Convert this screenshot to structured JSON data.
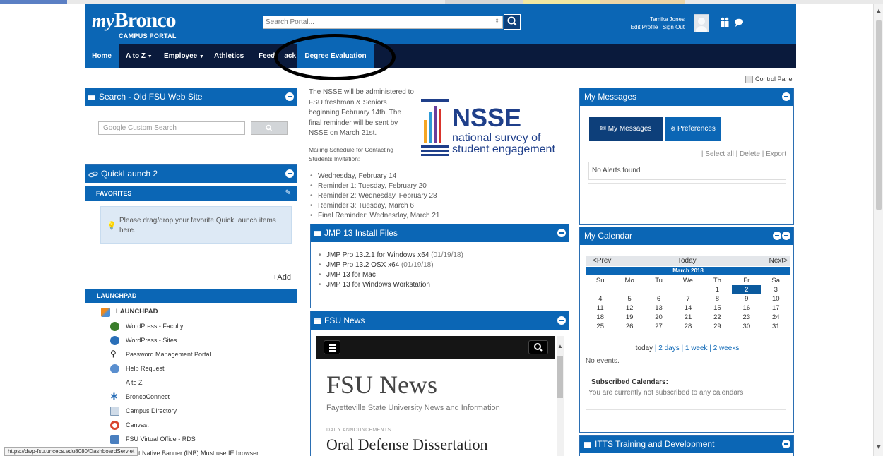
{
  "header": {
    "logo_my": "my",
    "logo_bronco": "Bronco",
    "logo_sub": "CAMPUS PORTAL",
    "search_placeholder": "Search Portal...",
    "user_name": "Tamika Jones",
    "user_links": "Edit Profile | Sign Out"
  },
  "nav": {
    "items": [
      "Home",
      "A to Z",
      "Employee",
      "Athletics",
      "Feedback",
      "Degree Evaluation"
    ],
    "feed_visible_left": "Feed",
    "feed_visible_right": "ack"
  },
  "control_panel": "Control Panel",
  "search_old": {
    "title": "Search - Old FSU Web Site",
    "placeholder": "Google Custom Search"
  },
  "quicklaunch": {
    "title": "QuickLaunch 2",
    "favorites": "FAVORITES",
    "drag_hint": "Please drag/drop your favorite QuickLaunch items here.",
    "add": "+Add",
    "launchpad_bar": "LAUNCHPAD",
    "launchpad_heading": "LAUNCHPAD",
    "items": [
      "WordPress - Faculty",
      "WordPress - Sites",
      "Password Management Portal",
      "Help Request",
      "A to Z",
      "BroncoConnect",
      "Campus Directory",
      "Canvas.",
      "FSU Virtual Office - RDS",
      "rnet Native Banner (INB) Must use IE browser."
    ]
  },
  "nsse": {
    "intro": "The NSSE will be administered to FSU freshman & Seniors beginning February 14th. The final reminder will be sent by NSSE on March 21st.",
    "mailing": "Mailing Schedule for Contacting Students Invitation:",
    "schedule": [
      "Wednesday, February 14",
      "Reminder 1:  Tuesday, February 20",
      "Reminder 2:  Wednesday, February 28",
      "Reminder 3:  Tuesday, March 6",
      "Final Reminder:  Wednesday, March 21"
    ],
    "logo_title": "NSSE",
    "logo_line1": "national survey of",
    "logo_line2": "student engagement"
  },
  "jmp": {
    "title": "JMP 13 Install Files",
    "items": [
      {
        "text": "JMP Pro 13.2.1 for Windows x64",
        "date": " (01/19/18)"
      },
      {
        "text": "JMP Pro 13.2 OSX x64",
        "date": " (01/19/18)"
      },
      {
        "text": "JMP 13 for Mac",
        "date": ""
      },
      {
        "text": "JMP 13 for Windows Workstation",
        "date": ""
      }
    ]
  },
  "fsu_news": {
    "title": "FSU News",
    "headline": "FSU News",
    "subtitle": "Fayetteville State University News and Information",
    "kicker": "DAILY ANNOUNCEMENTS",
    "story": "Oral Defense Dissertation"
  },
  "messages": {
    "title": "My Messages",
    "tab_messages": "My Messages",
    "tab_preferences": "Preferences",
    "actions": "| Select all  |  Delete  |  Export",
    "empty": "No Alerts found"
  },
  "calendar": {
    "title": "My Calendar",
    "prev": "<Prev",
    "today": "Today",
    "next": "Next>",
    "month": "March 2018",
    "weekdays": [
      "Su",
      "Mo",
      "Tu",
      "We",
      "Th",
      "Fr",
      "Sa"
    ],
    "weeks": [
      [
        "",
        "",
        "",
        "",
        "1",
        "2",
        "3"
      ],
      [
        "4",
        "5",
        "6",
        "7",
        "8",
        "9",
        "10"
      ],
      [
        "11",
        "12",
        "13",
        "14",
        "15",
        "16",
        "17"
      ],
      [
        "18",
        "19",
        "20",
        "21",
        "22",
        "23",
        "24"
      ],
      [
        "25",
        "26",
        "27",
        "28",
        "29",
        "30",
        "31"
      ]
    ],
    "selected": "2",
    "range_today": "today",
    "range_rest": " | 2 days | 1 week | 2 weeks",
    "no_events": "No events.",
    "subscribed_title": "Subscribed Calendars:",
    "subscribed_text": "You are currently not subscribed to any calendars"
  },
  "itts": {
    "title": "ITTS Training and Development"
  },
  "status_url": "https://dwp-fsu.uncecs.edu8080/DashboardServlet",
  "colors": {
    "primary": "#0b66b5",
    "nav": "#0a1a3c",
    "tab_dark": "#0d3f7a"
  }
}
